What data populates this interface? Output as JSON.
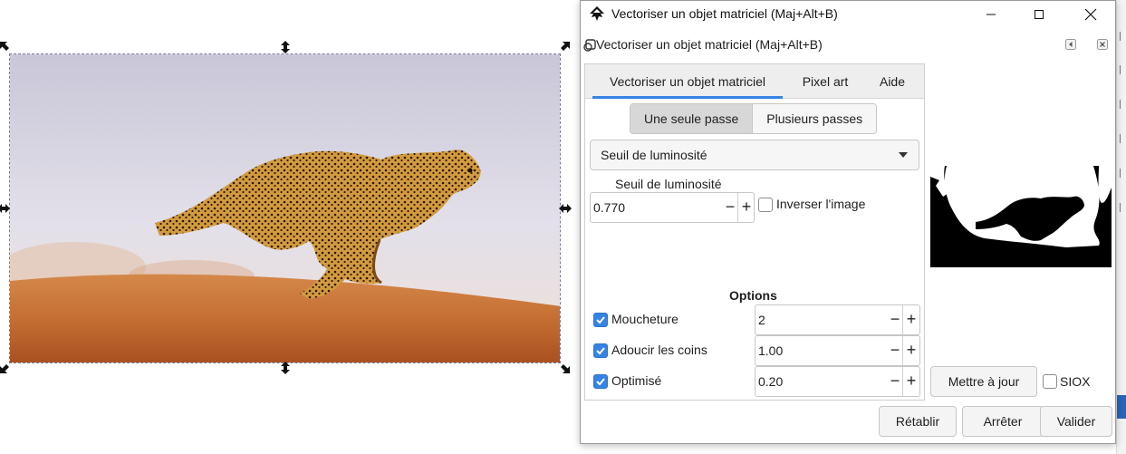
{
  "window": {
    "title": "Vectoriser un objet matriciel (Maj+Alt+B)",
    "panel_title": "Vectoriser un objet matriciel (Maj+Alt+B)"
  },
  "tabs": [
    {
      "label": "Vectoriser un objet matriciel",
      "active": true
    },
    {
      "label": "Pixel art",
      "active": false
    },
    {
      "label": "Aide",
      "active": false
    }
  ],
  "mode": {
    "single": "Une seule passe",
    "multi": "Plusieurs passes",
    "selected": "single"
  },
  "method": {
    "selected": "Seuil de luminosité"
  },
  "threshold": {
    "label": "Seuil de luminosité",
    "value": "0.770",
    "invert_label": "Inverser l'image",
    "invert_checked": false
  },
  "options": {
    "title": "Options",
    "items": [
      {
        "label": "Moucheture",
        "checked": true,
        "value": "2"
      },
      {
        "label": "Adoucir les coins",
        "checked": true,
        "value": "1.00"
      },
      {
        "label": "Optimisé",
        "checked": true,
        "value": "0.20"
      }
    ]
  },
  "preview": {
    "update_label": "Mettre à jour",
    "siox_label": "SIOX",
    "siox_checked": false
  },
  "buttons": {
    "reset": "Rétablir",
    "stop": "Arrêter",
    "apply": "Valider"
  },
  "spin": {
    "minus": "−",
    "plus": "+"
  },
  "icons": {
    "app": "inkscape-icon",
    "panel": "trace-bitmap-icon",
    "check": "check-icon"
  },
  "colors": {
    "accent": "#3584e4",
    "sand": "#c8733c",
    "sky": "#d9d9e8"
  }
}
